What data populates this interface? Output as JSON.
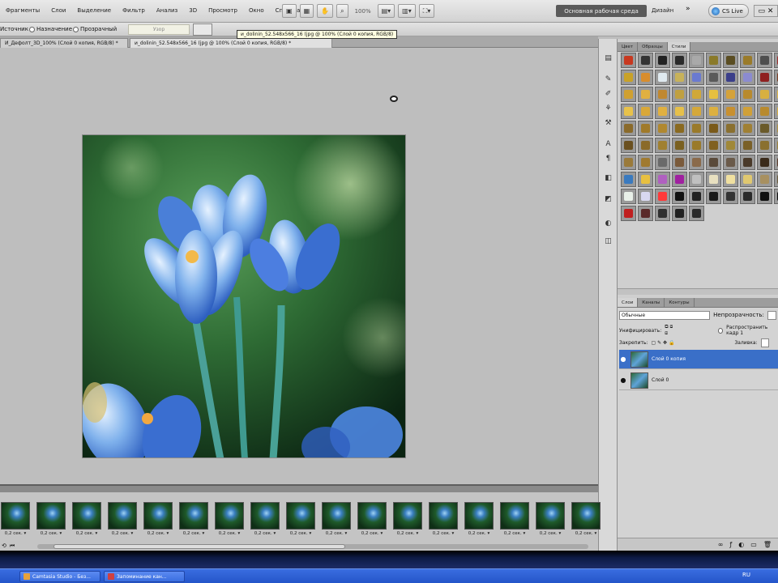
{
  "menubar": {
    "items": [
      "Фрагменты",
      "Слои",
      "Выделение",
      "Фильтр",
      "Анализ",
      "3D",
      "Просмотр",
      "Окно",
      "Справка"
    ],
    "zoom": "100%",
    "workspace_label": "Основная рабочая среда",
    "design_label": "Дизайн",
    "cs_live": "CS Live"
  },
  "options": {
    "radio1": "Источник",
    "radio2": "Назначение",
    "radio3": "Прозрачный",
    "field_placeholder": "Узор"
  },
  "tabs": {
    "tab1": "И_Дефолт_3D_100% (Слой 0 копия, RGB/8) *",
    "tab2": "и_dolinin_52.548x566_16 (jpg @ 100% (Слой 0 копия, RGB/8) *"
  },
  "tooltip": "и_dolinin_52.548x566_16 (jpg @ 100% (Слой 0 копия, RGB/8)",
  "styles_panel": {
    "tabs": [
      "Цвет",
      "Образцы",
      "Стили"
    ],
    "active_tab": 2,
    "swatches": [
      "#c8381f",
      "#333333",
      "#222222",
      "#2a2a2a",
      "#a9a9a9",
      "#8a7a2a",
      "#5a4d22",
      "#9a7b2a",
      "#4e4e4e",
      "#9b2a2a",
      "#c9a227",
      "#d88d2e",
      "#dfe9ef",
      "#c8b25a",
      "#6a7ad0",
      "#5a5a5a",
      "#3b3f8a",
      "#8b8bd0",
      "#8f2020",
      "#7a3a1f",
      "#d0a030",
      "#e0b040",
      "#c08830",
      "#c0a040",
      "#d0a838",
      "#e6c040",
      "#d4a23a",
      "#b88a2e",
      "#d8b040",
      "#e0b848",
      "#e8c24a",
      "#d9a838",
      "#e0b040",
      "#e6c04a",
      "#d4a83a",
      "#dcb040",
      "#c89030",
      "#d0a038",
      "#b88a2e",
      "#d9b040",
      "#8a6a2a",
      "#a07a2a",
      "#b08830",
      "#8a6a20",
      "#9a7a2a",
      "#7a5a1a",
      "#8a7030",
      "#a08034",
      "#6a5a2a",
      "#b09040",
      "#6a5020",
      "#8a6a2a",
      "#a08030",
      "#7a6020",
      "#9a7a2a",
      "#806020",
      "#a08838",
      "#7a6028",
      "#8a7030",
      "#9a8038",
      "#9a7a3a",
      "#a07a30",
      "#6a6a6a",
      "#7a5a3a",
      "#8a6a4a",
      "#5a4a3a",
      "#6a5a4a",
      "#4a3a2a",
      "#3a2a1a",
      "#5a3a2a",
      "#3a7abf",
      "#e8c040",
      "#b060c0",
      "#a020a0",
      "#c0c0c0",
      "#e8e0c0",
      "#f0e0a0",
      "#e0c870",
      "#a89060",
      "#6a5a3a",
      "#e8f0e8",
      "#d8d8f0",
      "#ff3a3a",
      "#111111",
      "#222222",
      "#1a1a1a",
      "#333333",
      "#2a2a2a",
      "#101010",
      "#0a0a0a",
      "#c02020",
      "#5a2a2a",
      "#303030",
      "#202020",
      "#2a2a2a"
    ]
  },
  "layers_panel": {
    "tabs": [
      "Слои",
      "Каналы",
      "Контуры"
    ],
    "blend_mode": "Обычные",
    "opacity_label": "Непрозрачность:",
    "unify_label": "Унифицировать:",
    "propagate_label": "Распространить кадр 1",
    "lock_label": "Закрепить:",
    "fill_label": "Заливка:",
    "layers": [
      {
        "name": "Слой 0 копия",
        "active": true
      },
      {
        "name": "Слой 0",
        "active": false
      }
    ]
  },
  "animation": {
    "frame_count": 17,
    "frame_delay": "0,2 сек.",
    "frame_loop": "▾"
  },
  "taskbar": {
    "button1": "Camtasia Studio - Без...",
    "button2": "Запоминание кан...",
    "clock": "RU"
  },
  "colors": {
    "accent_layer": "#3a6fc8",
    "taskbar": "#2455c9"
  }
}
